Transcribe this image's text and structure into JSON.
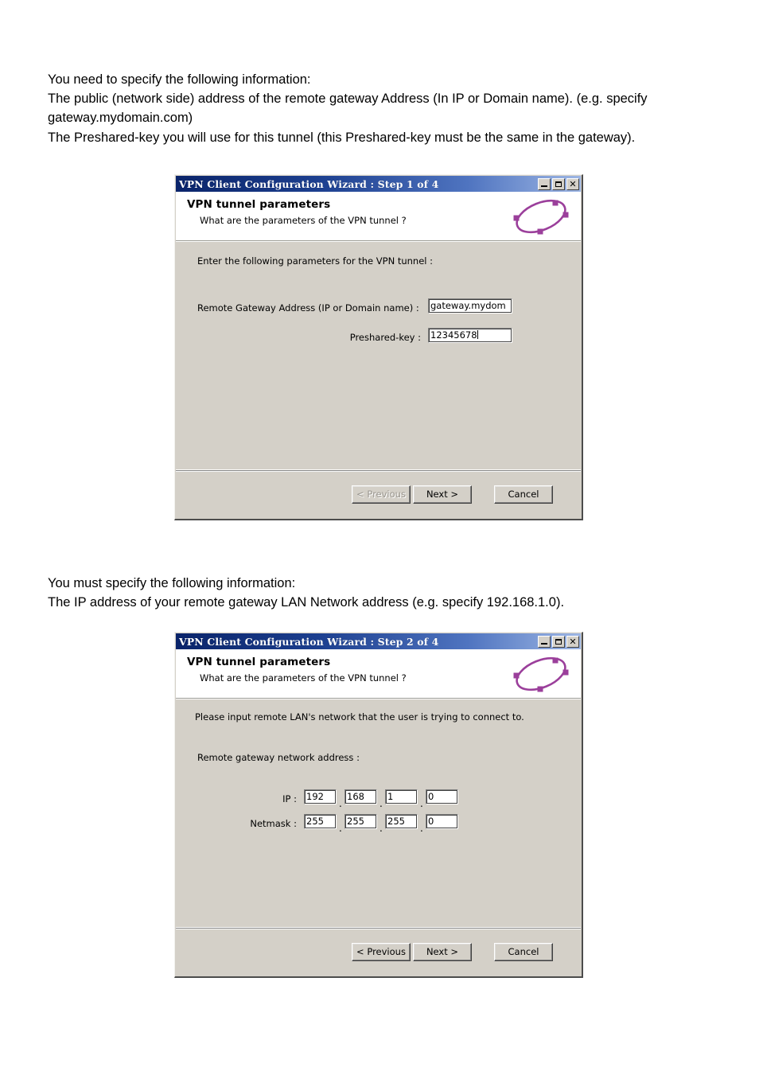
{
  "document": {
    "paragraph_one": {
      "line1": "You need to specify the following information:",
      "line2": "The public (network side) address of the remote gateway Address (In IP or Domain name). (e.g. specify gateway.mydomain.com)",
      "line3": "The Preshared-key you will use for this tunnel (this Preshared-key must be the same in the gateway)."
    },
    "paragraph_two": {
      "line1": "You must specify the following information:",
      "line2": "The IP address of your remote gateway LAN Network address (e.g. specify 192.168.1.0)."
    }
  },
  "colors": {
    "titlebar_start": "#0a246a",
    "titlebar_end": "#9db6e4",
    "dialog_face": "#d4d0c8",
    "logo_purple": "#9b3f9b",
    "disabled_text": "#9a968f"
  },
  "dialog_step1": {
    "titlebar": {
      "title": "VPN Client Configuration Wizard : Step 1 of 4",
      "minimize_label": "_",
      "maximize_label": "",
      "close_label": "✕"
    },
    "header": {
      "title": "VPN tunnel parameters",
      "subtitle": "What are the parameters of the VPN tunnel ?",
      "logo": "vpn-tunnel-ring-logo"
    },
    "body": {
      "intro": "Enter the following parameters for the VPN tunnel :",
      "gateway_label": "Remote Gateway Address (IP or Domain name) :",
      "gateway_value": "gateway.mydom",
      "preshared_label": "Preshared-key :",
      "preshared_value": "12345678"
    },
    "footer": {
      "previous_label": "< Previous",
      "previous_enabled": false,
      "next_label": "Next >",
      "cancel_label": "Cancel"
    }
  },
  "dialog_step2": {
    "titlebar": {
      "title": "VPN Client Configuration Wizard : Step 2 of 4",
      "minimize_label": "_",
      "maximize_label": "",
      "close_label": "✕"
    },
    "header": {
      "title": "VPN tunnel parameters",
      "subtitle": "What are the parameters of the VPN tunnel ?",
      "logo": "vpn-tunnel-ring-logo"
    },
    "body": {
      "intro": "Please input remote LAN's network that the user is trying to connect to.",
      "section_label": "Remote gateway network address :",
      "ip_label": "IP :",
      "ip_octets": [
        "192",
        "168",
        "1",
        "0"
      ],
      "netmask_label": "Netmask :",
      "netmask_octets": [
        "255",
        "255",
        "255",
        "0"
      ],
      "separator": "."
    },
    "footer": {
      "previous_label": "< Previous",
      "previous_enabled": true,
      "next_label": "Next >",
      "cancel_label": "Cancel"
    }
  }
}
